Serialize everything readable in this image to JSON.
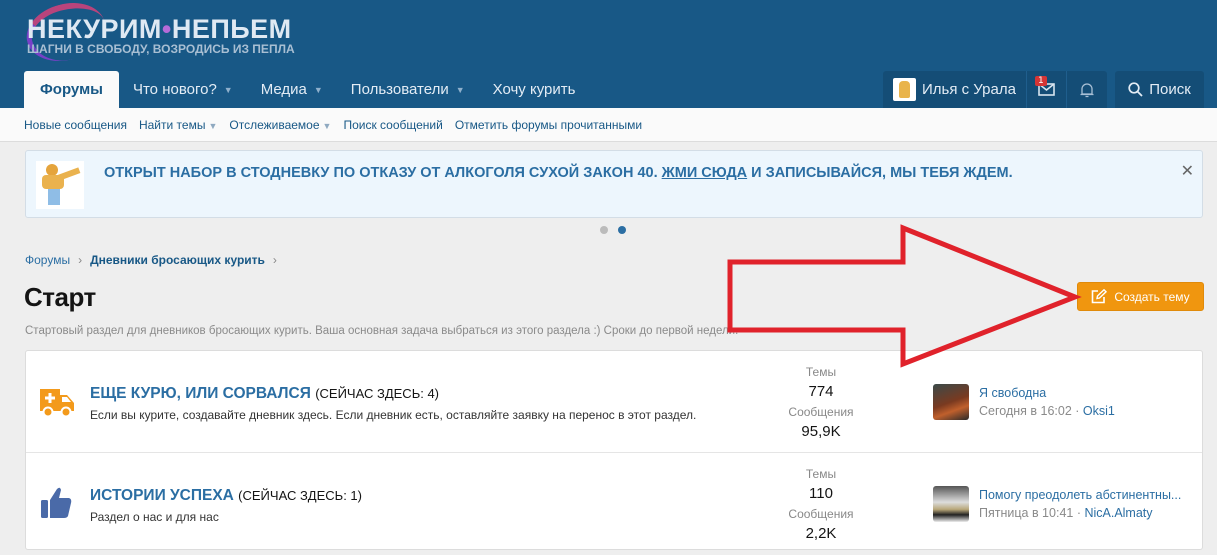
{
  "logo": {
    "main_left": "НЕКУРИМ",
    "main_right": "НЕПЬЕМ",
    "tagline": "ШАГНИ В СВОБОДУ, ВОЗРОДИСЬ ИЗ ПЕПЛА"
  },
  "nav": {
    "tabs": [
      {
        "label": "Форумы"
      },
      {
        "label": "Что нового?"
      },
      {
        "label": "Медиа"
      },
      {
        "label": "Пользователи"
      },
      {
        "label": "Хочу курить"
      }
    ]
  },
  "user": {
    "name": "Илья с Урала",
    "inbox_count": "1",
    "search_label": "Поиск"
  },
  "subnav": {
    "items": [
      {
        "label": "Новые сообщения"
      },
      {
        "label": "Найти темы"
      },
      {
        "label": "Отслеживаемое"
      },
      {
        "label": "Поиск сообщений"
      },
      {
        "label": "Отметить форумы прочитанными"
      }
    ]
  },
  "banner": {
    "text": "ОТКРЫТ НАБОР В СТОДНЕВКУ ПО ОТКАЗУ ОТ АЛКОГОЛЯ СУХОЙ ЗАКОН 40.",
    "link": "ЖМИ СЮДА",
    "text_after": "И ЗАПИСЫВАЙСЯ, МЫ ТЕБЯ ЖДЕМ.",
    "close": "✕"
  },
  "breadcrumb": {
    "items": [
      {
        "label": "Форумы"
      },
      {
        "label": "Дневники бросающих курить"
      }
    ]
  },
  "page": {
    "title": "Старт",
    "description": "Стартовый раздел для дневников бросающих курить. Ваша основная задача выбраться из этого раздела :) Сроки до первой недели.",
    "create_label": "Создать тему"
  },
  "colors": {
    "header": "#185886",
    "accent": "#f0960f",
    "link": "#2b6ea3",
    "annotation": "#e0222b"
  },
  "forums": [
    {
      "title": "ЕЩЕ КУРЮ, ИЛИ СОРВАЛСЯ",
      "online": "(СЕЙЧАС ЗДЕСЬ: 4)",
      "description": "Если вы курите, создавайте дневник здесь. Если дневник есть, оставляйте заявку на перенос в этот раздел.",
      "threads_label": "Темы",
      "threads": "774",
      "messages_label": "Сообщения",
      "messages": "95,9K",
      "last_title": "Я свободна",
      "last_time": "Сегодня в 16:02",
      "last_user": "Oksi1",
      "icon": "ambulance-icon"
    },
    {
      "title": "ИСТОРИИ УСПЕХА",
      "online": "(СЕЙЧАС ЗДЕСЬ: 1)",
      "description": "Раздел о нас и для нас",
      "threads_label": "Темы",
      "threads": "110",
      "messages_label": "Сообщения",
      "messages": "2,2K",
      "last_title": "Помогу преодолеть абстинентны...",
      "last_time": "Пятница в 10:41",
      "last_user": "NicA.Almaty",
      "icon": "thumbs-up-icon"
    }
  ]
}
